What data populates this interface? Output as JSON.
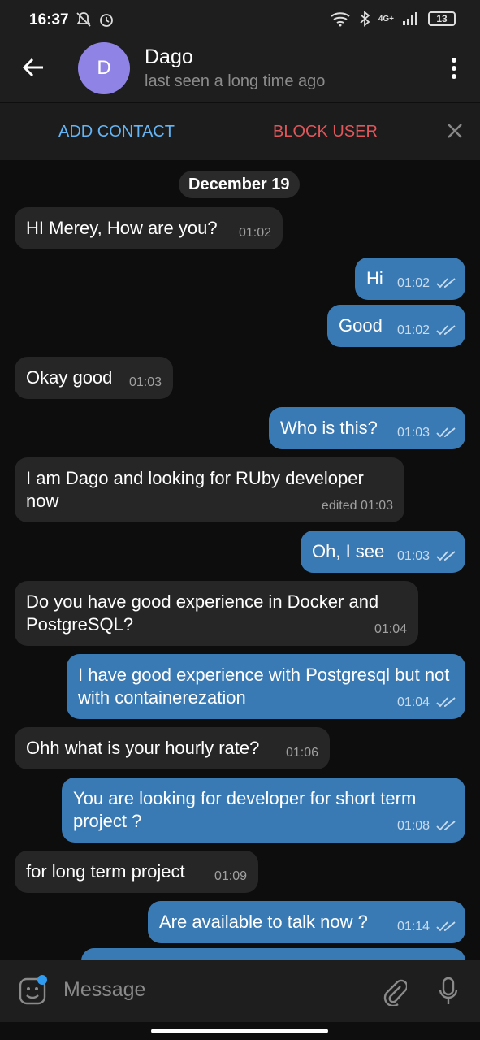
{
  "status_bar": {
    "time": "16:37",
    "network": "4G+",
    "battery": "13"
  },
  "header": {
    "avatar_letter": "D",
    "name": "Dago",
    "status": "last seen a long time ago"
  },
  "actions": {
    "add_contact": "ADD CONTACT",
    "block_user": "BLOCK USER"
  },
  "chat": {
    "date": "December 19",
    "messages": [
      {
        "dir": "in",
        "text": "HI Merey, How are you?",
        "time": "01:02"
      },
      {
        "dir": "out",
        "text": "Hi",
        "time": "01:02"
      },
      {
        "dir": "out",
        "text": "Good",
        "time": "01:02"
      },
      {
        "dir": "in",
        "text": "Okay good",
        "time": "01:03"
      },
      {
        "dir": "out",
        "text": "Who is this?",
        "time": "01:03"
      },
      {
        "dir": "in",
        "text": "I am Dago and looking for RUby developer now",
        "time": "edited 01:03"
      },
      {
        "dir": "out",
        "text": "Oh, I see",
        "time": "01:03"
      },
      {
        "dir": "in",
        "text": "Do you have good experience in Docker and PostgreSQL?",
        "time": "01:04"
      },
      {
        "dir": "out",
        "text": "I have good experience with Postgresql but not with containerezation",
        "time": "01:04"
      },
      {
        "dir": "in",
        "text": "Ohh what is your hourly rate?",
        "time": "01:06"
      },
      {
        "dir": "out",
        "text": "You are looking for developer for short term project ?",
        "time": "01:08"
      },
      {
        "dir": "in",
        "text": "for long term project",
        "time": "01:09"
      },
      {
        "dir": "out",
        "text": "Are available to talk now ?",
        "time": "01:14"
      }
    ]
  },
  "composer": {
    "placeholder": "Message"
  }
}
